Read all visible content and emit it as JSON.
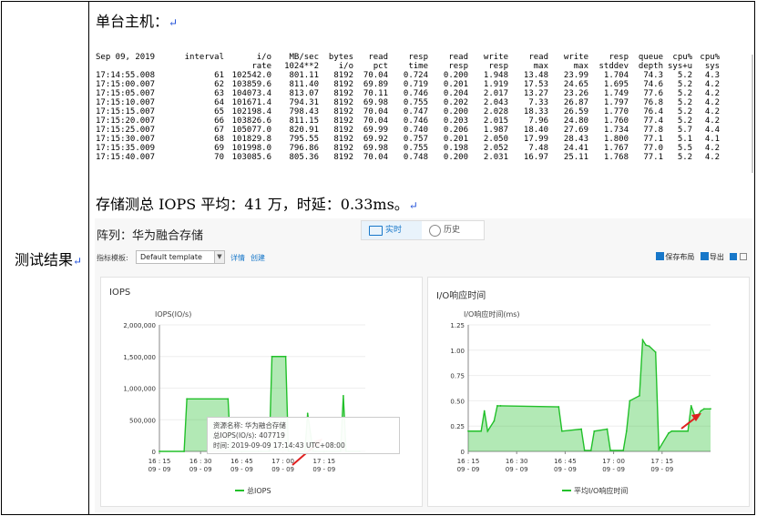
{
  "row_label": "测试结果",
  "return_mark": "↵",
  "section1_title": "单台主机：",
  "console": {
    "header1": [
      "Sep 09, 2019",
      "interval",
      "i/o",
      "MB/sec",
      "bytes",
      "read",
      "resp",
      "read",
      "write",
      "read",
      "write",
      "resp",
      "queue",
      "cpu%",
      "cpu%"
    ],
    "header2": [
      "",
      "",
      "rate",
      "1024**2",
      "i/o",
      "pct",
      "time",
      "resp",
      "resp",
      "max",
      "max",
      "stddev",
      "depth",
      "sys+u",
      "sys"
    ],
    "rows": [
      [
        "17:14:55.008",
        "61",
        "102542.0",
        "801.11",
        "8192",
        "70.04",
        "0.724",
        "0.200",
        "1.948",
        "13.48",
        "23.99",
        "1.704",
        "74.3",
        "5.2",
        "4.3"
      ],
      [
        "17:15:00.007",
        "62",
        "103859.6",
        "811.40",
        "8192",
        "69.89",
        "0.719",
        "0.201",
        "1.919",
        "17.53",
        "24.65",
        "1.695",
        "74.6",
        "5.2",
        "4.2"
      ],
      [
        "17:15:05.007",
        "63",
        "104073.4",
        "813.07",
        "8192",
        "70.11",
        "0.746",
        "0.204",
        "2.017",
        "13.27",
        "23.26",
        "1.749",
        "77.6",
        "5.2",
        "4.2"
      ],
      [
        "17:15:10.007",
        "64",
        "101671.4",
        "794.31",
        "8192",
        "69.98",
        "0.755",
        "0.202",
        "2.043",
        "7.33",
        "26.87",
        "1.797",
        "76.8",
        "5.2",
        "4.2"
      ],
      [
        "17:15:15.007",
        "65",
        "102198.4",
        "798.43",
        "8192",
        "70.04",
        "0.747",
        "0.200",
        "2.028",
        "18.33",
        "26.59",
        "1.770",
        "76.4",
        "5.2",
        "4.2"
      ],
      [
        "17:15:20.007",
        "66",
        "103826.6",
        "811.15",
        "8192",
        "70.04",
        "0.746",
        "0.203",
        "2.015",
        "7.96",
        "24.80",
        "1.760",
        "77.4",
        "5.2",
        "4.2"
      ],
      [
        "17:15:25.007",
        "67",
        "105077.0",
        "820.91",
        "8192",
        "69.99",
        "0.740",
        "0.206",
        "1.987",
        "18.40",
        "27.69",
        "1.734",
        "77.8",
        "5.7",
        "4.4"
      ],
      [
        "17:15:30.007",
        "68",
        "101829.8",
        "795.55",
        "8192",
        "69.92",
        "0.757",
        "0.201",
        "2.050",
        "17.99",
        "28.43",
        "1.800",
        "77.1",
        "5.1",
        "4.1"
      ],
      [
        "17:15:35.009",
        "69",
        "101998.0",
        "796.86",
        "8192",
        "69.98",
        "0.755",
        "0.198",
        "2.052",
        "7.48",
        "24.41",
        "1.767",
        "77.0",
        "5.5",
        "4.2"
      ],
      [
        "17:15:40.007",
        "70",
        "103085.6",
        "805.36",
        "8192",
        "70.04",
        "0.748",
        "0.200",
        "2.031",
        "16.97",
        "25.11",
        "1.768",
        "77.1",
        "5.2",
        "4.2"
      ]
    ]
  },
  "section2_title": "存储测总 IOPS 平均：41 万，时延：0.33ms。",
  "panel": {
    "array_title": "阵列：华为融合存储",
    "tab_live": "实时",
    "tab_history": "历史",
    "template_label": "指标模板:",
    "template_value": "Default template",
    "link_detail": "详情",
    "link_create": "创建",
    "save_layout": "保存布局",
    "export": "导出",
    "accent": "#1777c9"
  },
  "chart_data": [
    {
      "type": "area",
      "title": "IOPS",
      "ylabel": "IOPS(IO/s)",
      "ylim": [
        0,
        2000000
      ],
      "yticks": [
        "2,000,000",
        "1,500,000",
        "1,000,000",
        "500,000",
        "0"
      ],
      "xticks": [
        "16 : 15",
        "16 : 30",
        "16 : 45",
        "17 : 00",
        "17 : 15"
      ],
      "xticks_date": [
        "09 - 09",
        "09 - 09",
        "09 - 09",
        "09 - 09",
        "09 - 09"
      ],
      "legend": "总IOPS",
      "color": "#22c02a",
      "x_minutes": [
        0,
        9,
        10,
        25,
        26,
        36,
        37,
        40,
        41,
        46,
        47,
        49,
        50,
        53,
        54,
        56,
        57,
        60,
        61,
        66,
        67,
        68,
        69,
        73
      ],
      "values": [
        0,
        0,
        830000,
        830000,
        0,
        0,
        0,
        0,
        1500000,
        1500000,
        0,
        0,
        0,
        0,
        600000,
        0,
        0,
        0,
        0,
        0,
        880000,
        0,
        0,
        0
      ],
      "tooltip": {
        "resource_label": "资源名称:",
        "resource_value": "华为融合存储",
        "metric_label": "总IOPS(IO/s):",
        "metric_value": "407719",
        "time_label": "时间:",
        "time_value": "2019-09-09 17:14:43 UTC+08:00"
      }
    },
    {
      "type": "area",
      "title": "I/O响应时间",
      "ylabel": "I/O响应时间(ms)",
      "ylim": [
        0,
        1.25
      ],
      "yticks": [
        "1.25",
        "1.00",
        "0.75",
        "0.50",
        "0.25",
        "0"
      ],
      "xticks": [
        "16 : 15",
        "16 : 30",
        "16 : 45",
        "17 : 00",
        "17 : 15"
      ],
      "xticks_date": [
        "09 - 09",
        "09 - 09",
        "09 - 09",
        "09 - 09",
        "09 - 09"
      ],
      "legend": "平均I/O响应时间",
      "color": "#22c02a",
      "x_minutes": [
        0,
        4,
        5,
        6,
        8,
        9,
        10,
        28,
        29,
        35,
        36,
        38,
        39,
        43,
        44,
        48,
        49,
        50,
        53,
        54,
        55,
        56,
        58,
        59,
        62,
        63,
        68,
        69,
        70,
        71,
        72,
        73,
        75
      ],
      "values": [
        0.2,
        0.2,
        0.4,
        0.2,
        0.3,
        0.45,
        0.45,
        0.44,
        0.2,
        0.22,
        0.01,
        0.01,
        0.2,
        0.22,
        0.01,
        0.01,
        0.2,
        0.5,
        0.55,
        1.1,
        1.05,
        1.04,
        0.98,
        0.02,
        0.18,
        0.2,
        0.2,
        0.45,
        0.36,
        0.35,
        0.4,
        0.42,
        0.42
      ]
    }
  ]
}
